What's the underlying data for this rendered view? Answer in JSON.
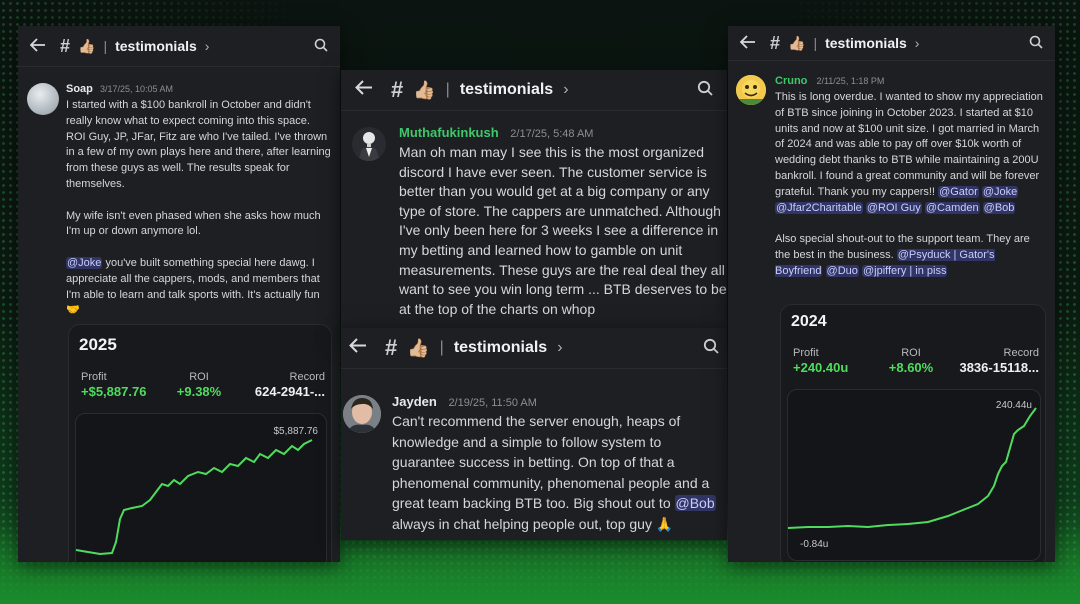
{
  "channel_name": "testimonials",
  "channel_emoji": "👍🏼",
  "panel_left": {
    "author": "Soap",
    "time": "3/17/25, 10:05 AM",
    "p1": "I started with a $100 bankroll in October and didn't really know what to expect coming into this space. ROI Guy, JP, JFar, Fitz are who I've tailed. I've thrown in a few of my own plays here and there, after learning from these guys as well. The results speak for themselves.",
    "p2": "My wife isn't even phased when she asks how much I'm up or down anymore lol.",
    "p3_mention": "@Joke",
    "p3_text": " you've built something special here dawg. I appreciate all the cappers, mods, and members that I'm able to learn and talk sports with. It's actually fun 🤝",
    "card": {
      "year": "2025",
      "profit_label": "Profit",
      "profit": "+$5,887.76",
      "roi_label": "ROI",
      "roi": "+9.38%",
      "record_label": "Record",
      "record": "624-2941-...",
      "chart_top_label": "$5,887.76"
    }
  },
  "panel_mid_top": {
    "author": "Muthafukinkush",
    "time": "2/17/25, 5:48 AM",
    "text": "Man oh man may I see this is the most organized discord I have ever seen. The customer service is better than you would get at a big company or any type of store. The cappers are unmatched. Although I've only been here for 3 weeks I see a difference in my betting and learned how to gamble on unit measurements. These guys are the real deal they all want to see you win long term ... BTB deserves to be at the top of the charts on whop"
  },
  "panel_mid_bottom": {
    "author": "Jayden",
    "time": "2/19/25, 11:50 AM",
    "text": "Can't recommend the server enough, heaps of knowledge and a simple to follow system to guarantee success in betting. On top of that a phenomenal community, phenomenal people and a great team backing BTB too. Big shout out to ",
    "mention": "@Bob",
    "text2": " always in chat helping people out, top guy 🙏"
  },
  "panel_right": {
    "author": "Cruno",
    "time": "2/11/25, 1:18 PM",
    "p1": "This is long overdue. I wanted to show my appreciation of BTB since joining in October 2023. I started at $10 units and now at $100 unit size. I got married in March of 2024 and was able to pay off over $10k worth of wedding debt thanks to BTB while maintaining a 200U bankroll. I found a great community and will be forever grateful. Thank you my cappers!!",
    "p1_mentions": [
      "@Gator",
      "@Joke",
      "@Jfar2Charitable",
      "@ROI Guy",
      "@Camden",
      "@Bob"
    ],
    "p2": "Also special shout-out to the support team. They are the best in the business.",
    "p2_mentions": [
      "@Psyduck | Gator's Boyfriend",
      "@Duo",
      "@jpiffery | in piss"
    ],
    "card": {
      "year": "2024",
      "profit_label": "Profit",
      "profit": "+240.40u",
      "roi_label": "ROI",
      "roi": "+8.60%",
      "record_label": "Record",
      "record": "3836-15118...",
      "chart_top_label": "240.44u",
      "chart_bottom_label": "-0.84u"
    }
  },
  "colors": {
    "green": "#4fdc5e",
    "author_green": "#3fc76a",
    "mention_bg": "#3b3f8a",
    "panel_bg": "#1e1f23"
  },
  "icons": [
    "back-arrow-icon",
    "hash-icon",
    "thumbs-up-icon",
    "chevron-right-icon",
    "search-icon"
  ]
}
